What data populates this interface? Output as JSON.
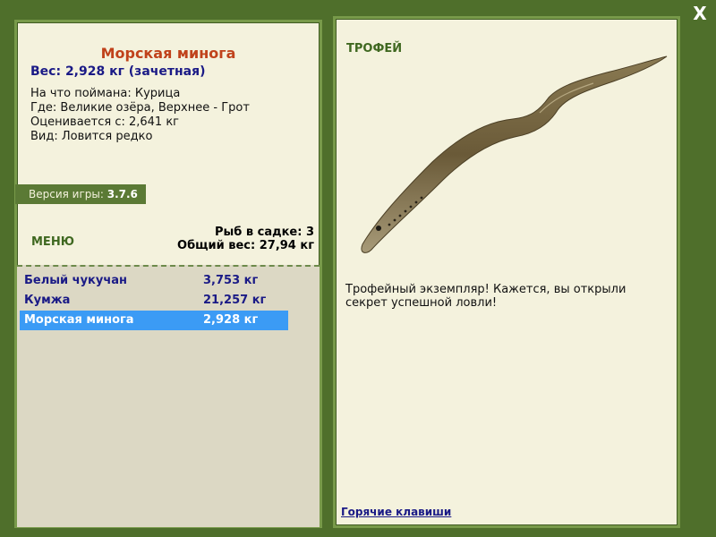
{
  "close": {
    "label": "X"
  },
  "left": {
    "fish_title": "Морская минога",
    "weight_line": "Вес: 2,928 кг (зачетная)",
    "info": [
      "На что поймана: Курица",
      "Где: Великие озёра, Верхнее - Грот",
      "Оценивается с: 2,641 кг",
      "Вид: Ловится редко"
    ],
    "version": {
      "label": "Версия игры:",
      "value": "3.7.6"
    },
    "menu_label": "МЕНЮ",
    "stats": {
      "fish_count": "Рыб в садке: 3",
      "total_weight": "Общий вес: 27,94 кг"
    },
    "fish_list": [
      {
        "name": "Белый чукучан",
        "weight": "3,753 кг",
        "selected": false
      },
      {
        "name": "Кумжа",
        "weight": "21,257 кг",
        "selected": false
      },
      {
        "name": "Морская минога",
        "weight": "2,928 кг",
        "selected": true
      }
    ]
  },
  "right": {
    "trophy_label": "ТРОФЕЙ",
    "description": "Трофейный экземпляр! Кажется, вы открыли секрет успешной ловли!",
    "hotkeys_link": "Горячие клавиши"
  },
  "colors": {
    "background": "#4f6f2b",
    "panel": "#f4f2dd",
    "title": "#c0421b",
    "accent_text": "#1a1a86",
    "selection": "#3b9bf5",
    "menu_green": "#3f6820"
  }
}
